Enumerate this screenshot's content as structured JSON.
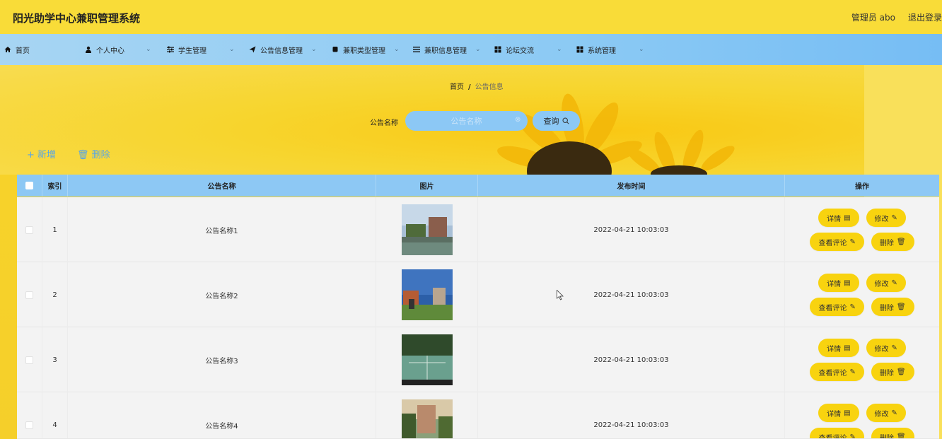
{
  "app": {
    "title": "阳光助学中心兼职管理系统"
  },
  "header": {
    "user": "管理员 abo",
    "logout": "退出登录"
  },
  "nav": {
    "items": [
      {
        "label": "首页",
        "icon": "home-icon"
      },
      {
        "label": "个人中心",
        "icon": "user-icon"
      },
      {
        "label": "学生管理",
        "icon": "sliders-icon"
      },
      {
        "label": "公告信息管理",
        "icon": "send-icon"
      },
      {
        "label": "兼职类型管理",
        "icon": "tag-icon"
      },
      {
        "label": "兼职信息管理",
        "icon": "list-icon"
      },
      {
        "label": "论坛交流",
        "icon": "grid-icon"
      },
      {
        "label": "系统管理",
        "icon": "grid-icon"
      }
    ]
  },
  "breadcrumb": {
    "home": "首页",
    "separator": "/",
    "current": "公告信息"
  },
  "search": {
    "label": "公告名称",
    "placeholder": "公告名称",
    "button": "查询"
  },
  "actions": {
    "add": "+ 新增",
    "delete": "删除"
  },
  "table": {
    "columns": [
      "索引",
      "公告名称",
      "图片",
      "发布时间",
      "操作"
    ],
    "rows": [
      {
        "index": "1",
        "name": "公告名称1",
        "time": "2022-04-21 10:03:03"
      },
      {
        "index": "2",
        "name": "公告名称2",
        "time": "2022-04-21 10:03:03"
      },
      {
        "index": "3",
        "name": "公告名称3",
        "time": "2022-04-21 10:03:03"
      },
      {
        "index": "4",
        "name": "公告名称4",
        "time": "2022-04-21 10:03:03"
      }
    ],
    "ops": {
      "detail": "详情",
      "edit": "修改",
      "comments": "查看评论",
      "delete": "删除"
    }
  },
  "colors": {
    "topbar": "#f9dc38",
    "nav": "#8ccaf4",
    "button": "#f8d30f",
    "header": "#8dc8f4"
  }
}
